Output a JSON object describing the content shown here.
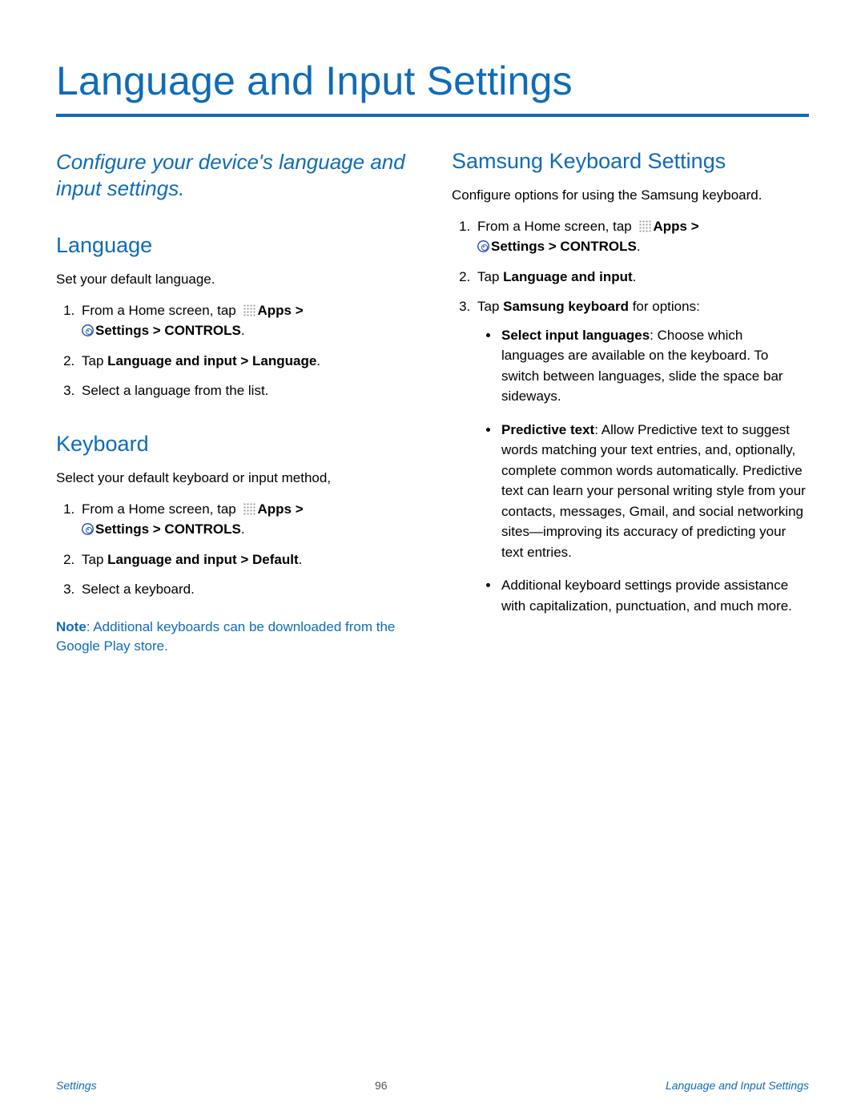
{
  "title": "Language and Input Settings",
  "intro": "Configure your device's language and input settings.",
  "left": {
    "language": {
      "heading": "Language",
      "desc": "Set your default language.",
      "step1_pre": "From a Home screen, tap ",
      "apps": "Apps",
      "gt": " >",
      "settings": "Settings",
      "controls": " > CONTROLS",
      "step2_pre": "Tap ",
      "step2_bold": "Language and input > Language",
      "period": ".",
      "step3": "Select a language from the list."
    },
    "keyboard": {
      "heading": "Keyboard",
      "desc": "Select your default keyboard or input method,",
      "step1_pre": "From a Home screen, tap ",
      "apps": "Apps",
      "gt": " >",
      "settings": "Settings",
      "controls": " > CONTROLS",
      "step2_pre": "Tap ",
      "step2_bold": "Language and input > Default",
      "period": ".",
      "step3": "Select a keyboard.",
      "note_label": "Note",
      "note_rest": ": Additional keyboards can be downloaded from the Google Play store."
    }
  },
  "right": {
    "heading": "Samsung Keyboard Settings",
    "desc": "Configure options for using the Samsung keyboard.",
    "step1_pre": "From a Home screen, tap ",
    "apps": "Apps",
    "gt": " >",
    "settings": "Settings",
    "controls": " > CONTROLS",
    "step2_pre": "Tap ",
    "step2_bold": "Language and input",
    "period": ".",
    "step3_pre": "Tap ",
    "step3_bold": "Samsung keyboard",
    "step3_post": " for options:",
    "bullets": {
      "b1_label": "Select input languages",
      "b1_rest": ": Choose which languages are available on the keyboard. To switch between languages, slide the space bar sideways.",
      "b2_label": "Predictive text",
      "b2_rest": ": Allow Predictive text to suggest words matching your text entries, and, optionally, complete common words automatically. Predictive text can learn your personal writing style from your contacts, messages, Gmail, and social networking sites—improving its accuracy of predicting your text entries.",
      "b3": "Additional keyboard settings provide assistance with capitalization, punctuation, and much more."
    }
  },
  "footer": {
    "left": "Settings",
    "center": "96",
    "right": "Language and Input Settings"
  }
}
